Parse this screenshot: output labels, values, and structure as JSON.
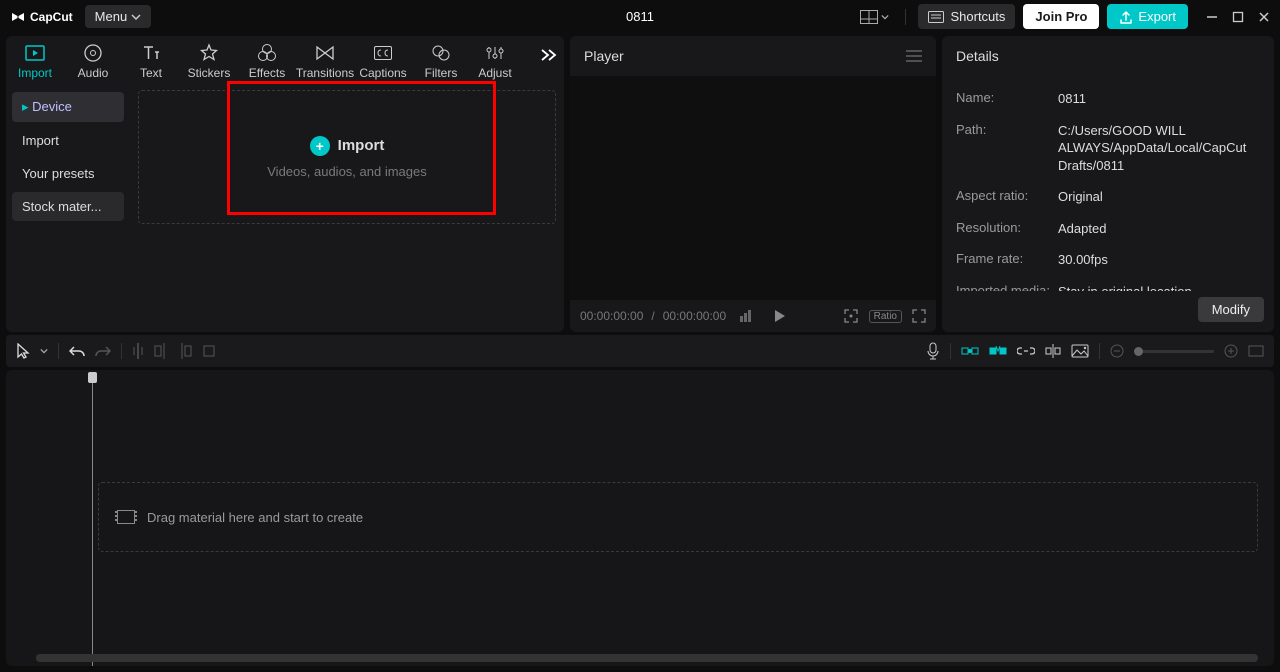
{
  "app": {
    "name": "CapCut",
    "menu_label": "Menu",
    "project_title": "0811"
  },
  "titlebar": {
    "shortcuts_label": "Shortcuts",
    "join_pro_label": "Join Pro",
    "export_label": "Export"
  },
  "tabs": [
    {
      "id": "import",
      "label": "Import",
      "active": true
    },
    {
      "id": "audio",
      "label": "Audio"
    },
    {
      "id": "text",
      "label": "Text"
    },
    {
      "id": "stickers",
      "label": "Stickers"
    },
    {
      "id": "effects",
      "label": "Effects"
    },
    {
      "id": "transitions",
      "label": "Transitions"
    },
    {
      "id": "captions",
      "label": "Captions"
    },
    {
      "id": "filters",
      "label": "Filters"
    },
    {
      "id": "adjust",
      "label": "Adjust"
    }
  ],
  "media_sidebar": [
    {
      "label": "Device",
      "active": true,
      "prefix": "▸ "
    },
    {
      "label": "Import"
    },
    {
      "label": "Your presets"
    },
    {
      "label": "Stock mater...",
      "stock": true
    }
  ],
  "import_drop": {
    "title": "Import",
    "subtitle": "Videos, audios, and images"
  },
  "player": {
    "header": "Player",
    "time_current": "00:00:00:00",
    "time_total": "00:00:00:00",
    "ratio_label": "Ratio"
  },
  "details": {
    "header": "Details",
    "rows": [
      {
        "label": "Name:",
        "value": "0811"
      },
      {
        "label": "Path:",
        "value": "C:/Users/GOOD WILL ALWAYS/AppData/Local/CapCut Drafts/0811"
      },
      {
        "label": "Aspect ratio:",
        "value": "Original"
      },
      {
        "label": "Resolution:",
        "value": "Adapted"
      },
      {
        "label": "Frame rate:",
        "value": "30.00fps"
      },
      {
        "label": "Imported media:",
        "value": "Stay in original location"
      }
    ],
    "modify_label": "Modify"
  },
  "timeline": {
    "drop_hint": "Drag material here and start to create"
  }
}
